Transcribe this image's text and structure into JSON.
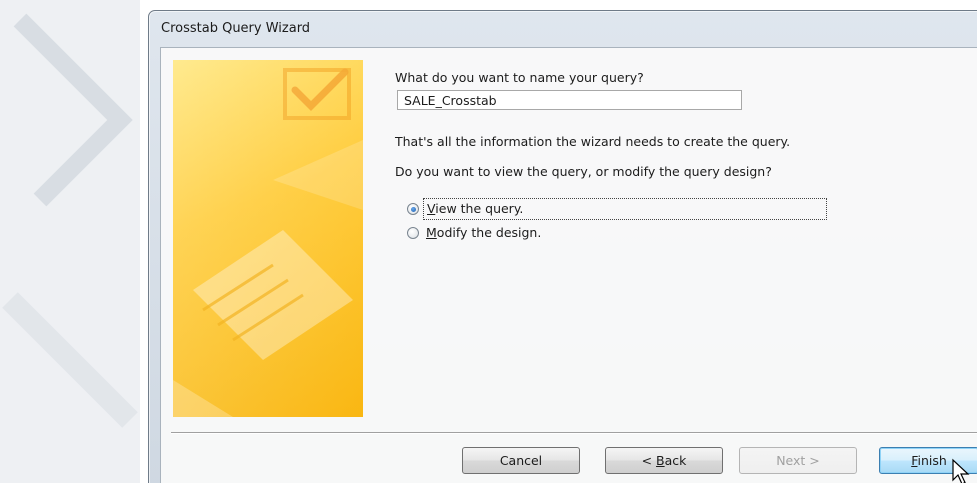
{
  "window": {
    "title": "Crosstab Query Wizard"
  },
  "wizard": {
    "name_question": "What do you want to name your query?",
    "query_name_value": "SALE_Crosstab",
    "info_line": "That's all the information the wizard needs to create the query.",
    "view_question": "Do you want to view the query, or modify the query design?",
    "options": [
      {
        "label_prefix": "",
        "label_accel": "V",
        "label_rest": "iew the query.",
        "selected": true
      },
      {
        "label_prefix": "",
        "label_accel": "M",
        "label_rest": "odify the design.",
        "selected": false
      }
    ]
  },
  "buttons": {
    "cancel": "Cancel",
    "back_prefix": "< ",
    "back_accel": "B",
    "back_rest": "ack",
    "next": "Next >",
    "finish_accel": "F",
    "finish_rest": "inish"
  },
  "icons": {
    "side_panel": "checkmark-document-icon",
    "cursor": "mouse-pointer-icon"
  },
  "colors": {
    "panel_yellow": "#ffcc33",
    "default_button_border": "#3c7fb1"
  }
}
